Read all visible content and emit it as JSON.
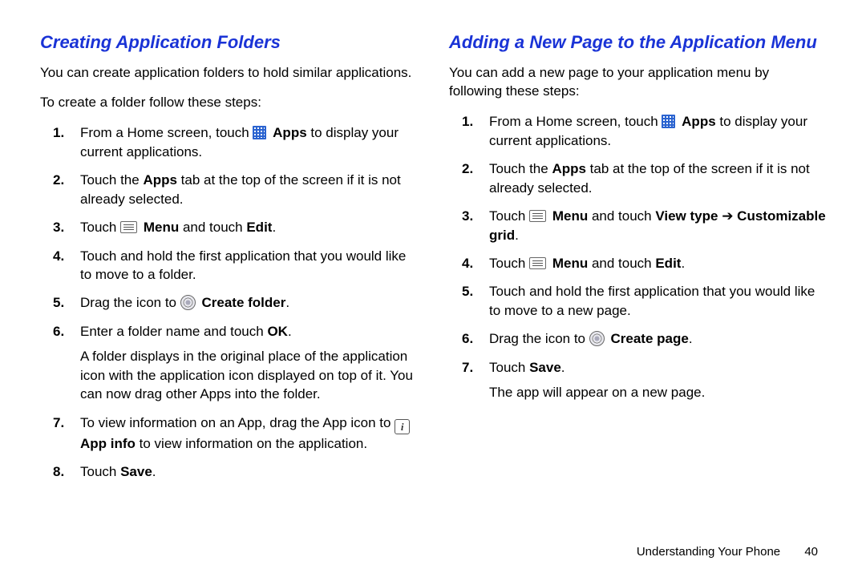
{
  "left": {
    "heading": "Creating Application Folders",
    "intro1": "You can create application folders to hold similar applications.",
    "intro2": "To create a folder follow these steps:",
    "s1a": "From a Home screen, touch ",
    "s1b": "Apps",
    "s1c": " to display your current applications.",
    "s2a": "Touch the ",
    "s2b": "Apps",
    "s2c": " tab at the top of the screen if it is not already selected.",
    "s3a": "Touch ",
    "s3b": "Menu",
    "s3c": " and touch ",
    "s3d": "Edit",
    "s3e": ".",
    "s4": "Touch and hold the first application that you would like to move to a folder.",
    "s5a": "Drag the icon to ",
    "s5b": "Create folder",
    "s5c": ".",
    "s6a": "Enter a folder name and touch ",
    "s6b": "OK",
    "s6c": ".",
    "s6d": "A folder displays in the original place of the application icon with the application icon displayed on top of it. You can now drag other Apps into the folder.",
    "s7a": "To view information on an App, drag the App icon to ",
    "s7b": "App info",
    "s7c": " to view information on the application.",
    "s8a": "Touch ",
    "s8b": "Save",
    "s8c": "."
  },
  "right": {
    "heading": "Adding a New Page to the Application Menu",
    "intro1": "You can add a new page to your application menu by following these steps:",
    "s1a": "From a Home screen, touch ",
    "s1b": "Apps",
    "s1c": " to display your current applications.",
    "s2a": "Touch the ",
    "s2b": "Apps",
    "s2c": " tab at the top of the screen if it is not already selected.",
    "s3a": "Touch ",
    "s3b": "Menu",
    "s3c": " and touch ",
    "s3d": "View type",
    "s3e": " ➔ ",
    "s3f": "Customizable grid",
    "s3g": ".",
    "s4a": "Touch ",
    "s4b": "Menu",
    "s4c": " and touch ",
    "s4d": "Edit",
    "s4e": ".",
    "s5": "Touch and hold the first application that you would like to move to a new page.",
    "s6a": "Drag the icon to ",
    "s6b": "Create page",
    "s6c": ".",
    "s7a": "Touch ",
    "s7b": "Save",
    "s7c": ".",
    "s7d": "The app will appear on a new page."
  },
  "footer": {
    "chapter": "Understanding Your Phone",
    "page": "40"
  },
  "info_glyph": "i"
}
